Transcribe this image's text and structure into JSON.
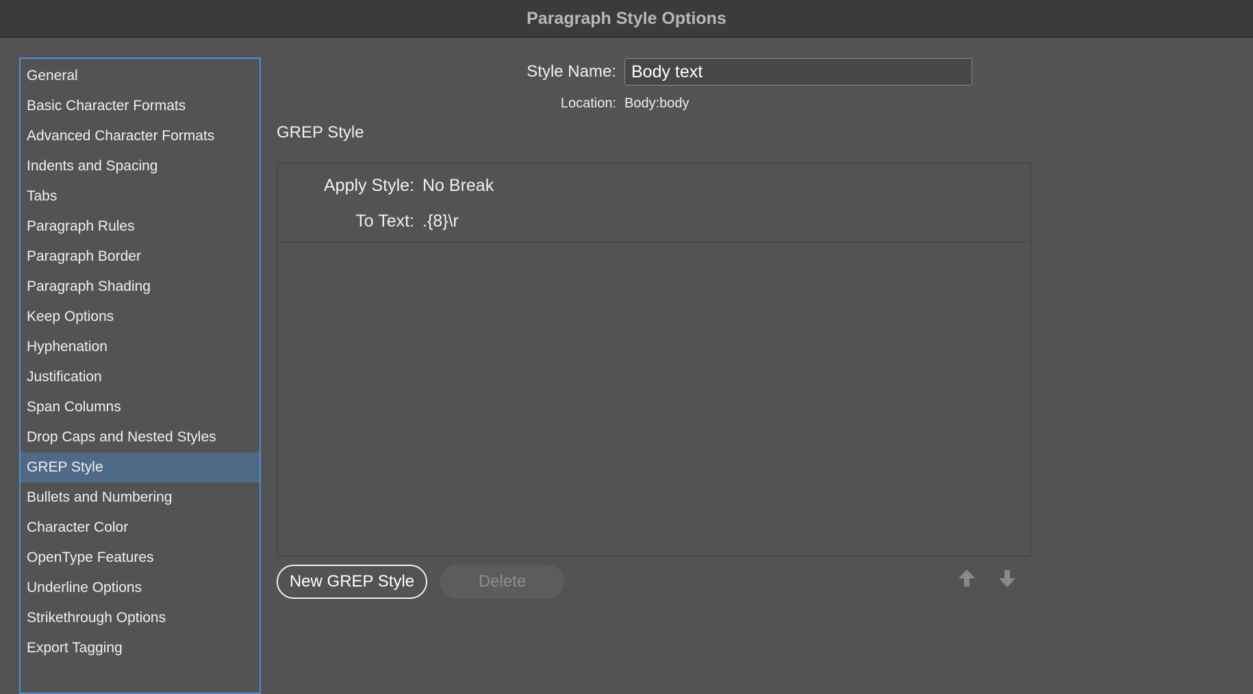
{
  "window": {
    "title": "Paragraph Style Options"
  },
  "sidebar": {
    "items": [
      {
        "label": "General"
      },
      {
        "label": "Basic Character Formats"
      },
      {
        "label": "Advanced Character Formats"
      },
      {
        "label": "Indents and Spacing"
      },
      {
        "label": "Tabs"
      },
      {
        "label": "Paragraph Rules"
      },
      {
        "label": "Paragraph Border"
      },
      {
        "label": "Paragraph Shading"
      },
      {
        "label": "Keep Options"
      },
      {
        "label": "Hyphenation"
      },
      {
        "label": "Justification"
      },
      {
        "label": "Span Columns"
      },
      {
        "label": "Drop Caps and Nested Styles"
      },
      {
        "label": "GREP Style"
      },
      {
        "label": "Bullets and Numbering"
      },
      {
        "label": "Character Color"
      },
      {
        "label": "OpenType Features"
      },
      {
        "label": "Underline Options"
      },
      {
        "label": "Strikethrough Options"
      },
      {
        "label": "Export Tagging"
      }
    ],
    "selected_label": "GREP Style"
  },
  "header": {
    "style_name_label": "Style Name:",
    "style_name_value": "Body text",
    "location_label": "Location:",
    "location_value": "Body:body"
  },
  "section": {
    "title": "GREP Style"
  },
  "grep_styles": [
    {
      "apply_style_label": "Apply Style:",
      "apply_style_value": "No Break",
      "to_text_label": "To Text:",
      "to_text_value": ".{8}\\r"
    }
  ],
  "buttons": {
    "new_grep_style": "New GREP Style",
    "delete": "Delete",
    "move_up_icon": "arrow-up-icon",
    "move_down_icon": "arrow-down-icon"
  },
  "colors": {
    "background": "#535353",
    "titlebar": "#3d3a3a",
    "sidebar_border": "#4a90d9",
    "sidebar_selected": "#4e6a87"
  }
}
